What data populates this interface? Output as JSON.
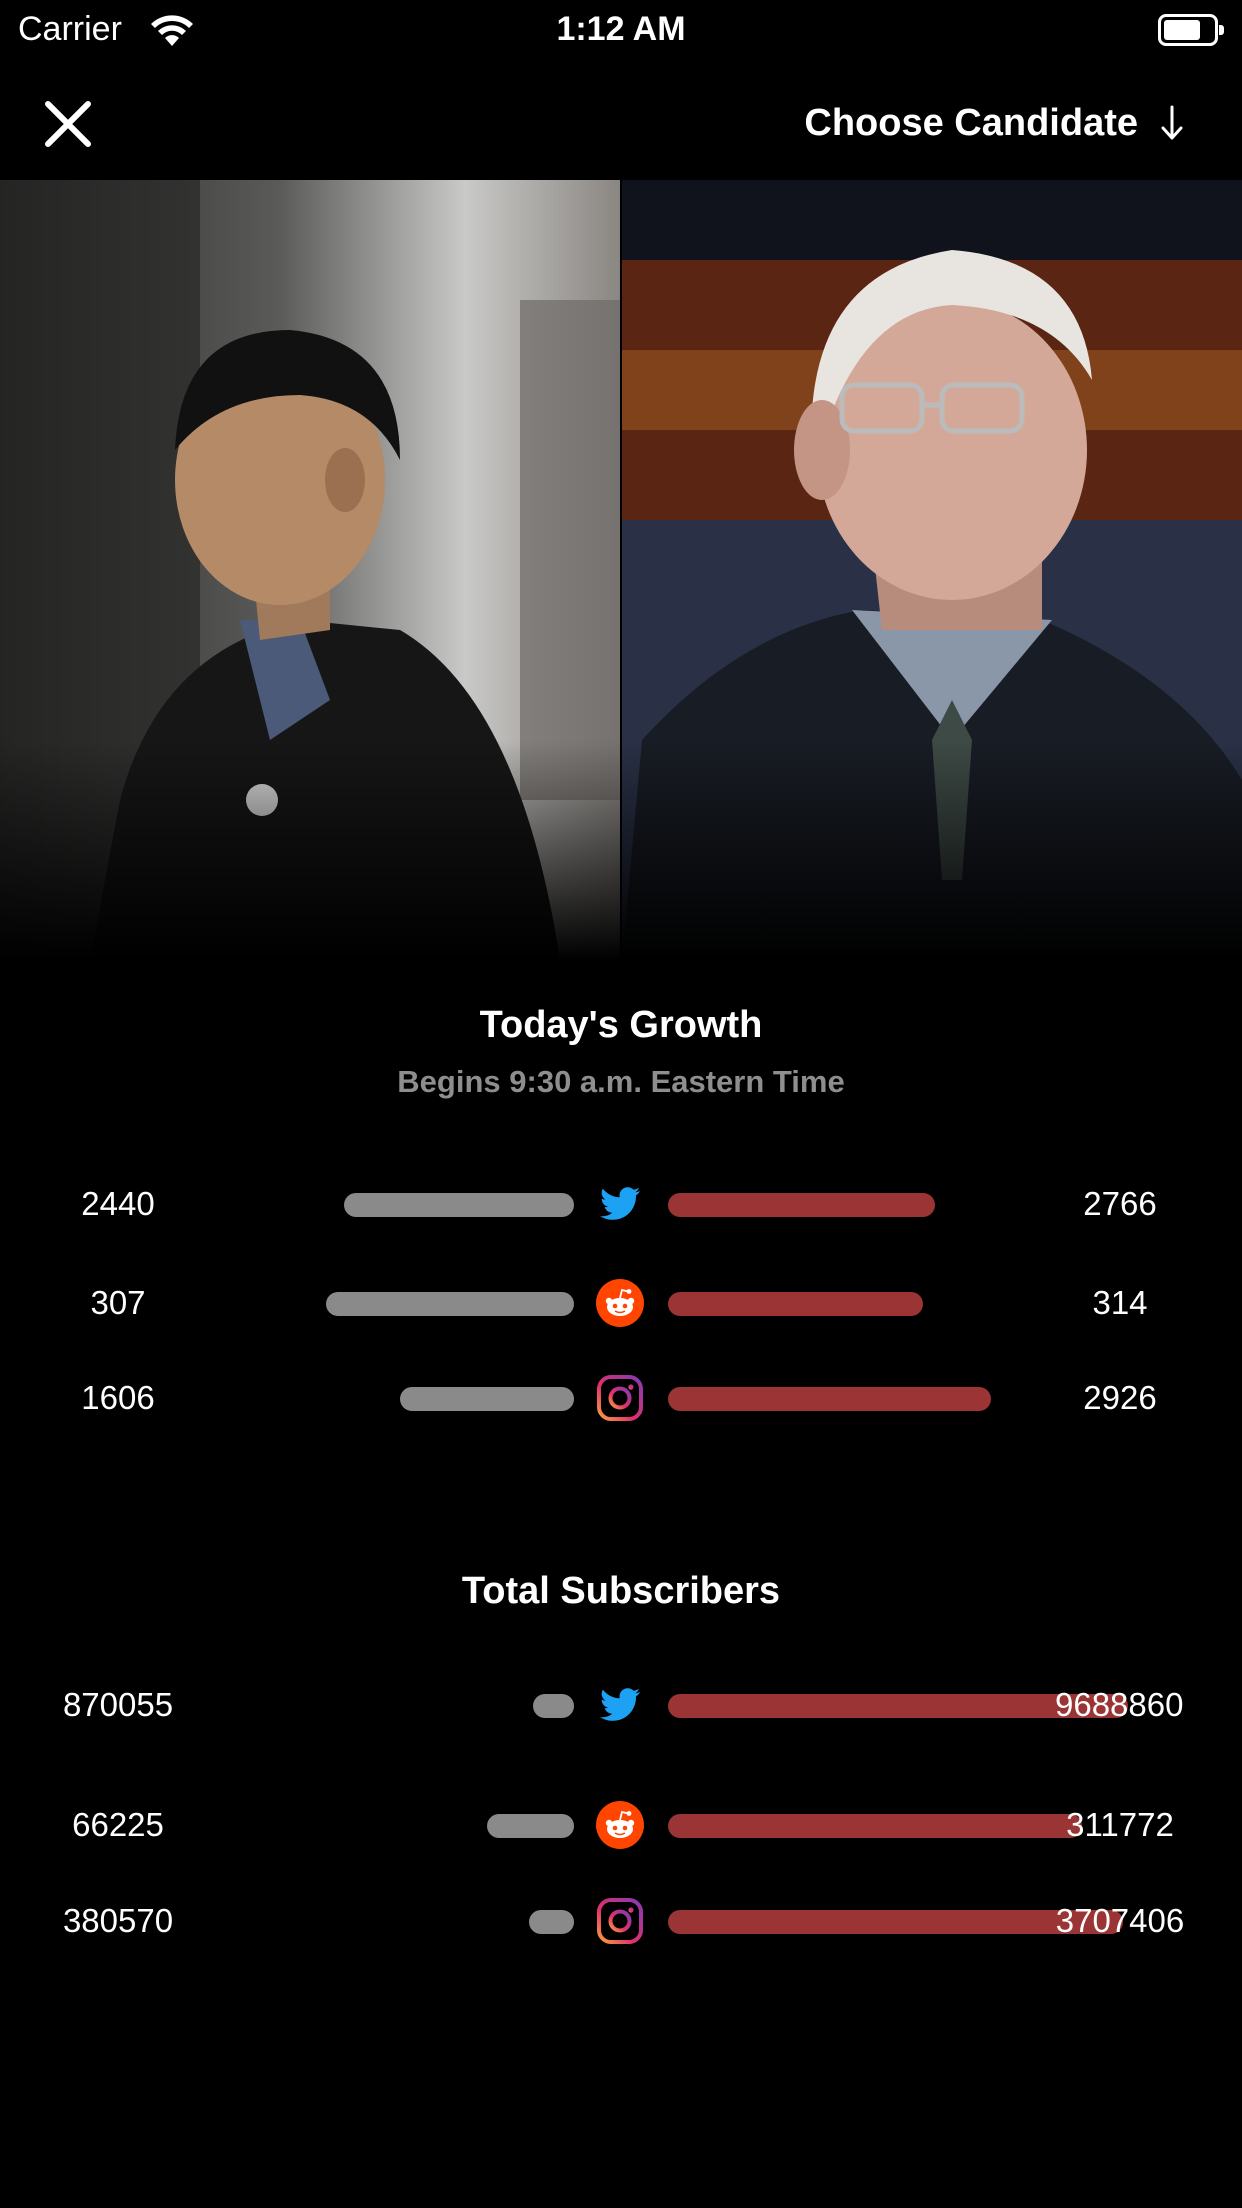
{
  "status_bar": {
    "carrier": "Carrier",
    "time": "1:12 AM",
    "battery_level": 0.75
  },
  "nav": {
    "choose_candidate_label": "Choose Candidate"
  },
  "icons": {
    "close": "close-icon",
    "choose": "arrow-down-icon",
    "twitter": "twitter-icon",
    "reddit": "reddit-icon",
    "instagram": "instagram-icon"
  },
  "colors": {
    "background": "#000000",
    "left_bar": "#8a8a8a",
    "right_bar": "#9b3434",
    "twitter": "#1da1f2",
    "reddit": "#ff4500",
    "subtitle": "#8e8e8e"
  },
  "growth": {
    "title": "Today's Growth",
    "subtitle": "Begins 9:30 a.m. Eastern Time",
    "rows": [
      {
        "platform": "twitter",
        "left": "2440",
        "right": "2766",
        "left_bar_ratio": 0.185,
        "right_bar_ratio": 0.215
      },
      {
        "platform": "reddit",
        "left": "307",
        "right": "314",
        "left_bar_ratio": 0.2,
        "right_bar_ratio": 0.205
      },
      {
        "platform": "instagram",
        "left": "1606",
        "right": "2926",
        "left_bar_ratio": 0.14,
        "right_bar_ratio": 0.26
      }
    ]
  },
  "totals": {
    "title": "Total Subscribers",
    "rows": [
      {
        "platform": "twitter",
        "left": "870055",
        "right": "9688860",
        "left_bar_ratio": 0.033,
        "right_bar_ratio": 0.37
      },
      {
        "platform": "reddit",
        "left": "66225",
        "right": "311772",
        "left_bar_ratio": 0.07,
        "right_bar_ratio": 0.333
      },
      {
        "platform": "instagram",
        "left": "380570",
        "right": "3707406",
        "left_bar_ratio": 0.036,
        "right_bar_ratio": 0.366
      }
    ]
  }
}
